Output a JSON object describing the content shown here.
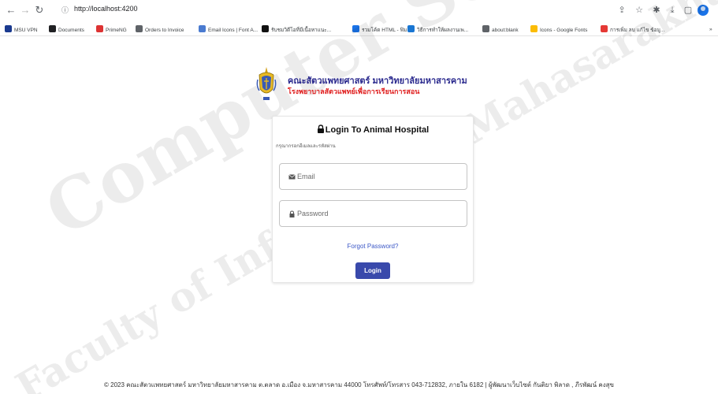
{
  "browser": {
    "url": "http://localhost:4200",
    "bookmarks": [
      {
        "label": "MSU VPN",
        "color": "#1a3a8f"
      },
      {
        "label": "Documents",
        "color": "#202124"
      },
      {
        "label": "PrimeNG",
        "color": "#dd3333"
      },
      {
        "label": "Orders to Invoice",
        "color": "#5f6368"
      },
      {
        "label": "Email Icons | Font A...",
        "color": "#4a7bd0"
      },
      {
        "label": "รับชมวิดีโอที่มีเนื้อหาแนะ...",
        "color": "#111111"
      },
      {
        "label": "รวมโค้ด HTML - ฟิมา...",
        "color": "#1a73e8"
      },
      {
        "label": "วิธีการทำให้ผลงานเพ...",
        "color": "#1976d2"
      },
      {
        "label": "about:blank",
        "color": "#5f6368"
      },
      {
        "label": "Icons - Google Fonts",
        "color": "#fbbc04"
      },
      {
        "label": "การเพิ่ม ลบ แก้ไข ข้อมู...",
        "color": "#e53935"
      }
    ]
  },
  "logo": {
    "line1": "คณะสัตวแพทยศาสตร์ มหาวิทยาลัยมหาสารคาม",
    "line2": "โรงพยาบาลสัตวแพทย์เพื่อการเรียนการสอน"
  },
  "login": {
    "title": "Login To Animal Hospital",
    "subtitle": "กรุณากรอกอีเมลและรหัสผ่าน",
    "email_placeholder": "Email",
    "password_placeholder": "Password",
    "forgot_label": "Forgot Password?",
    "login_label": "Login"
  },
  "watermark": {
    "line1": "Computer Science",
    "line2": "Faculty of Informatics, Mahasarakham University"
  },
  "footer": {
    "text": "© 2023 คณะสัตวแพทยศาสตร์ มหาวิทยาลัยมหาสารคาม ต.ตลาด อ.เมือง จ.มหาสารคาม 44000 โทรศัพท์/โทรสาร 043-712832, ภายใน 6182 | ผู้พัฒนาเว็บไซต์ กันติยา พิลาด , ภีรพัฒน์ คงสุข"
  },
  "colors": {
    "primary_button": "#3949ab",
    "link": "#3c58c7",
    "logo_blue": "#2b2a8e",
    "logo_red": "#e02020"
  }
}
